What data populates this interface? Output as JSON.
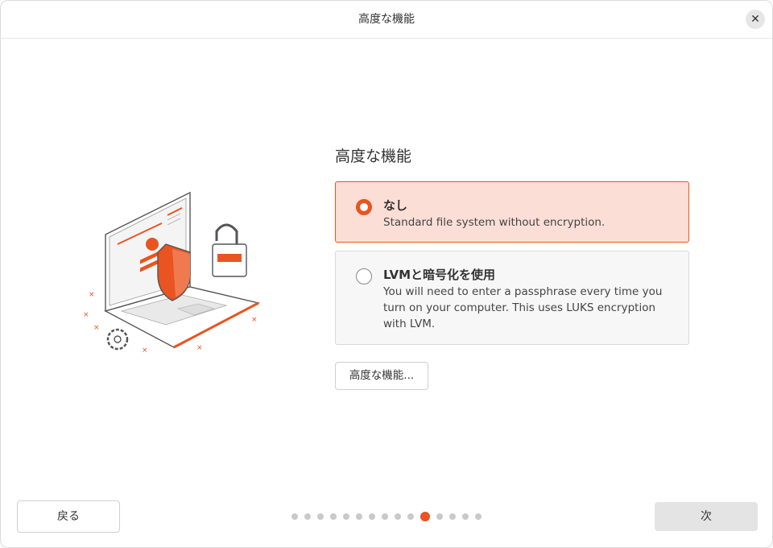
{
  "window": {
    "title": "高度な機能"
  },
  "close": {
    "glyph": "✕"
  },
  "main": {
    "heading": "高度な機能",
    "options": [
      {
        "title": "なし",
        "description": "Standard file system without encryption.",
        "selected": true
      },
      {
        "title": "LVMと暗号化を使用",
        "description": "You will need to enter a passphrase every time you turn on your computer. This uses LUKS encryption with LVM.",
        "selected": false
      }
    ],
    "advanced_button": "高度な機能..."
  },
  "footer": {
    "back_label": "戻る",
    "next_label": "次",
    "progress": {
      "total_steps": 14,
      "current_step": 11
    }
  },
  "colors": {
    "accent": "#e95420",
    "selected_bg": "#fbdfd6"
  },
  "icons": [
    "close-icon",
    "laptop-security-illustration"
  ]
}
